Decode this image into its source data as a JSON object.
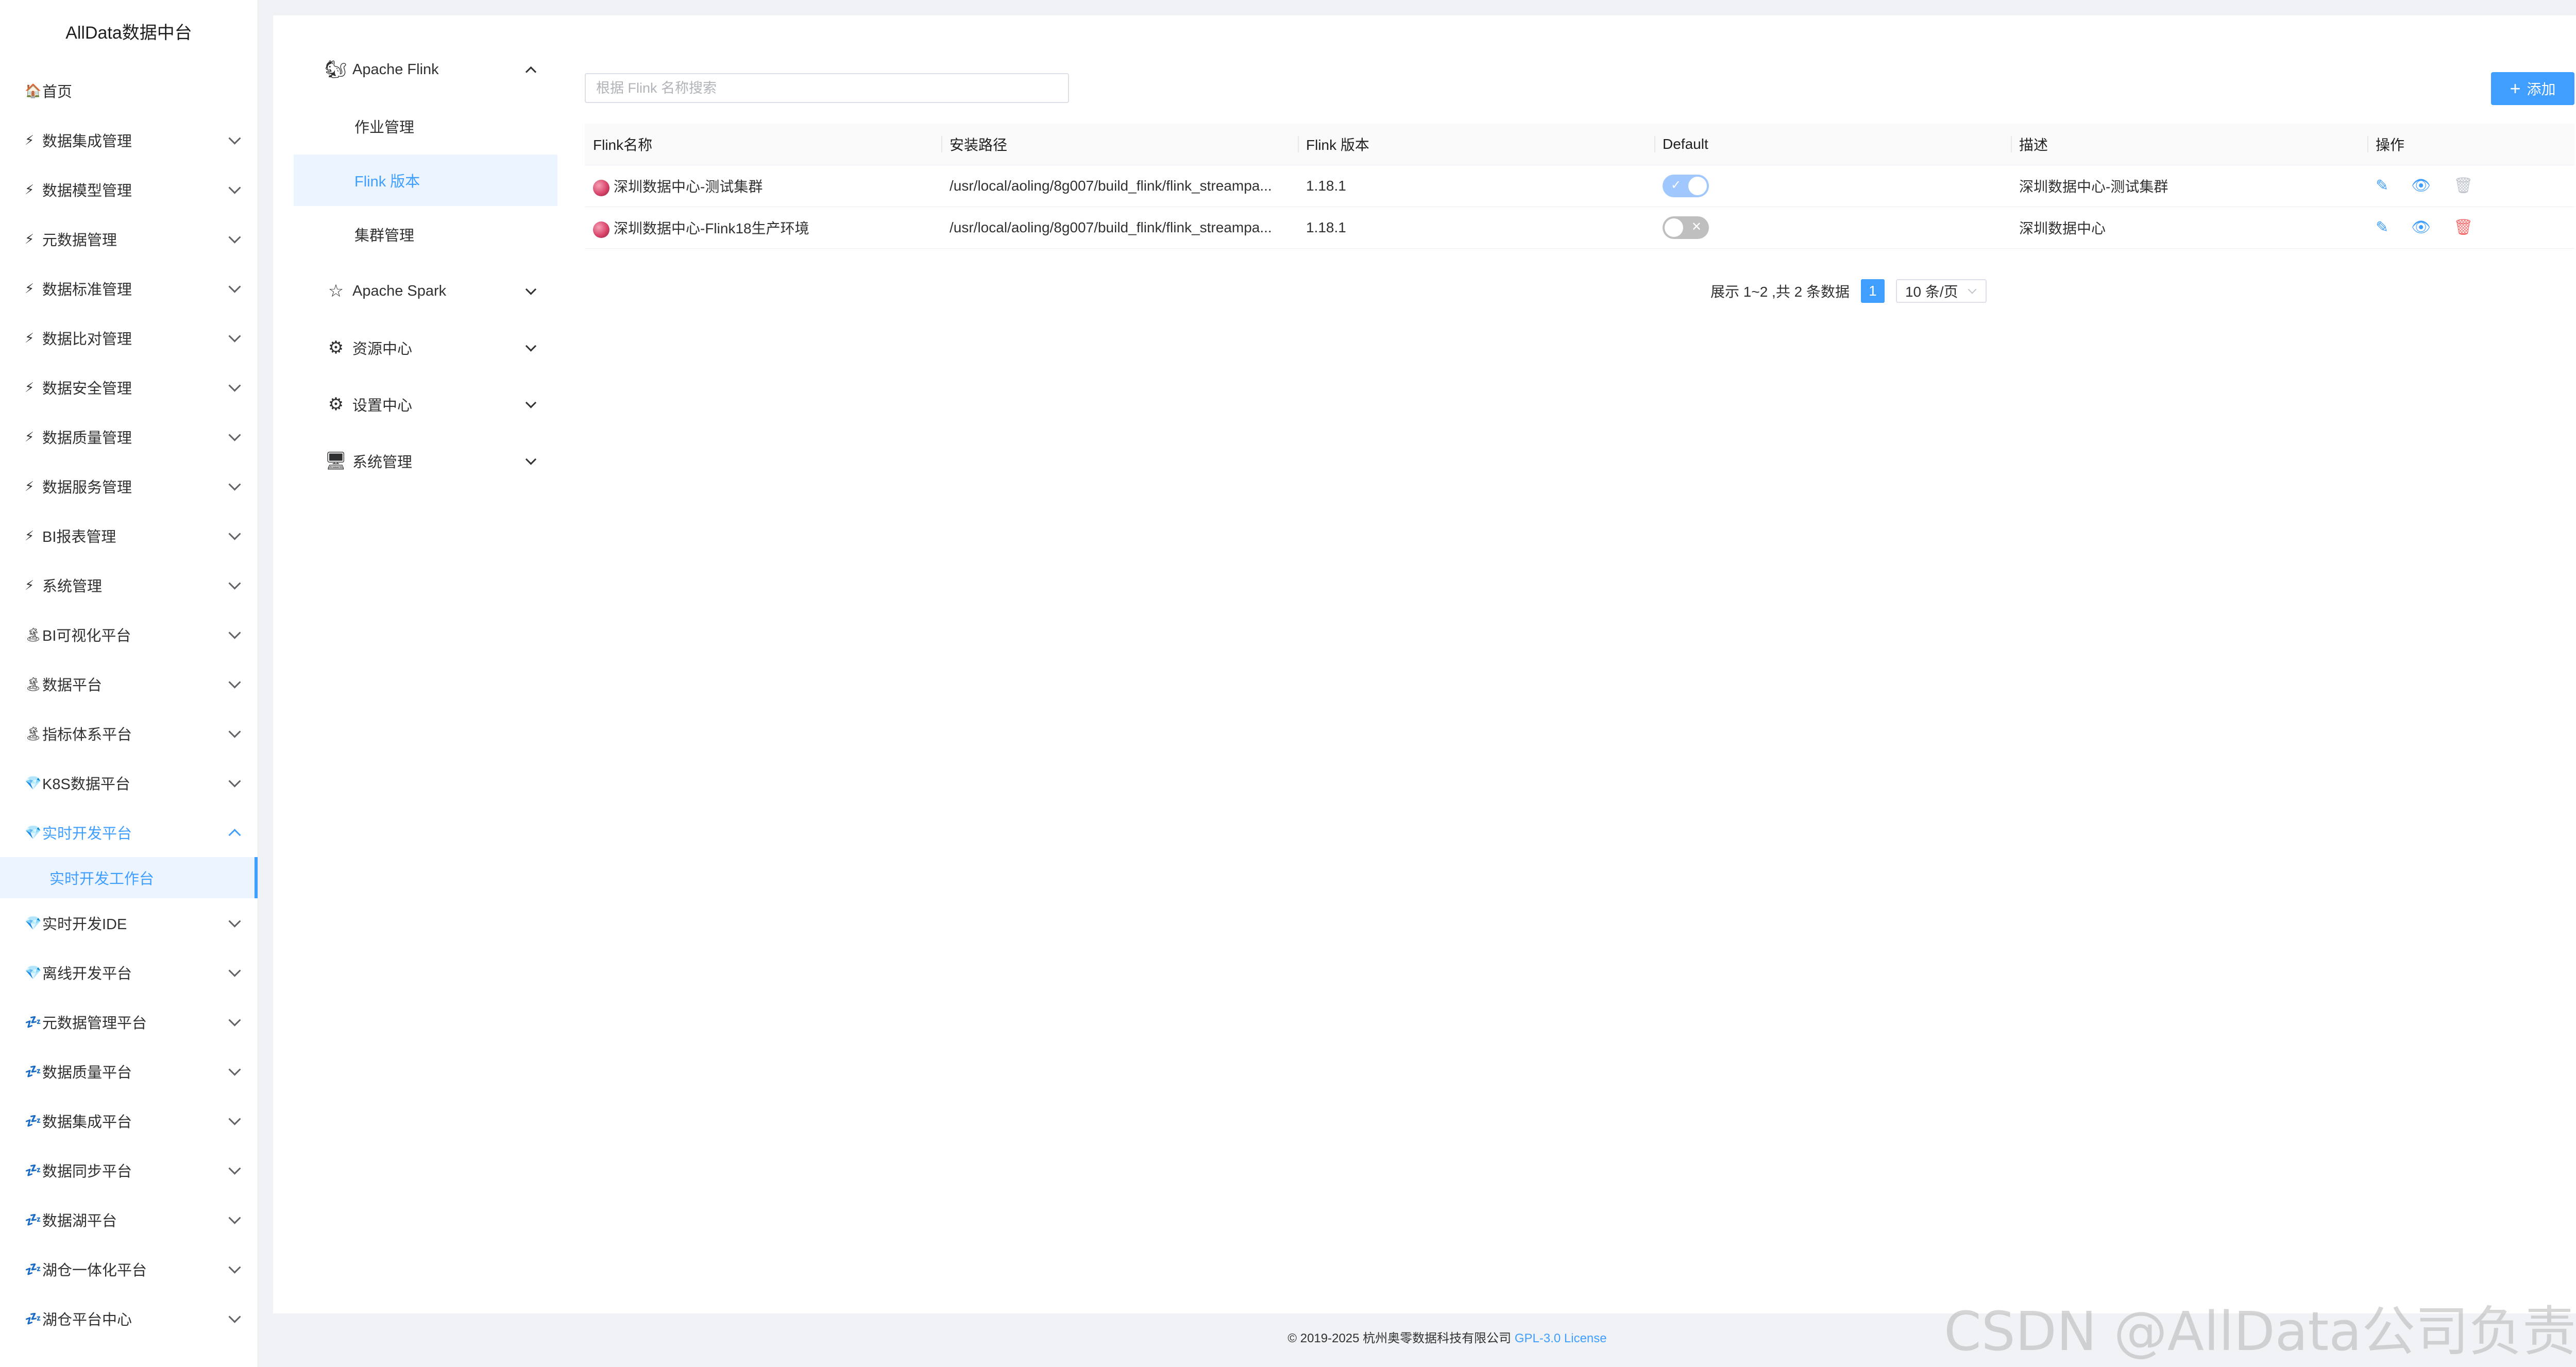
{
  "app": {
    "title": "AllData数据中台"
  },
  "sidebar": {
    "items": [
      {
        "label": "首页",
        "icon": "🏠",
        "arrow": false
      },
      {
        "label": "数据集成管理",
        "icon": "⚡",
        "arrow": true
      },
      {
        "label": "数据模型管理",
        "icon": "⚡",
        "arrow": true
      },
      {
        "label": "元数据管理",
        "icon": "⚡",
        "arrow": true
      },
      {
        "label": "数据标准管理",
        "icon": "⚡",
        "arrow": true
      },
      {
        "label": "数据比对管理",
        "icon": "⚡",
        "arrow": true
      },
      {
        "label": "数据安全管理",
        "icon": "⚡",
        "arrow": true
      },
      {
        "label": "数据质量管理",
        "icon": "⚡",
        "arrow": true
      },
      {
        "label": "数据服务管理",
        "icon": "⚡",
        "arrow": true
      },
      {
        "label": "BI报表管理",
        "icon": "⚡",
        "arrow": true
      },
      {
        "label": "系统管理",
        "icon": "⚡",
        "arrow": true
      },
      {
        "label": "BI可视化平台",
        "icon": "🏝",
        "arrow": true
      },
      {
        "label": "数据平台",
        "icon": "🏝",
        "arrow": true
      },
      {
        "label": "指标体系平台",
        "icon": "🏝",
        "arrow": true
      },
      {
        "label": "K8S数据平台",
        "icon": "💎",
        "arrow": true
      },
      {
        "label": "实时开发平台",
        "icon": "💎",
        "arrow": true,
        "open": true
      },
      {
        "label": "实时开发IDE",
        "icon": "💎",
        "arrow": true
      },
      {
        "label": "离线开发平台",
        "icon": "💎",
        "arrow": true
      },
      {
        "label": "元数据管理平台",
        "icon": "💤",
        "arrow": true
      },
      {
        "label": "数据质量平台",
        "icon": "💤",
        "arrow": true
      },
      {
        "label": "数据集成平台",
        "icon": "💤",
        "arrow": true
      },
      {
        "label": "数据同步平台",
        "icon": "💤",
        "arrow": true
      },
      {
        "label": "数据湖平台",
        "icon": "💤",
        "arrow": true
      },
      {
        "label": "湖仓一体化平台",
        "icon": "💤",
        "arrow": true
      },
      {
        "label": "湖仓平台中心",
        "icon": "💤",
        "arrow": true
      }
    ],
    "active_sub": "实时开发工作台"
  },
  "inner_menu": {
    "flink": {
      "label": "Apache Flink",
      "icon": "squirrel-icon"
    },
    "flink_subs": [
      {
        "label": "作业管理",
        "active": false
      },
      {
        "label": "Flink 版本",
        "active": true
      },
      {
        "label": "集群管理",
        "active": false
      }
    ],
    "groups": [
      {
        "label": "Apache Spark",
        "icon": "☆"
      },
      {
        "label": "资源中心",
        "icon": "⚙"
      },
      {
        "label": "设置中心",
        "icon": "⚙"
      },
      {
        "label": "系统管理",
        "icon": "🖥"
      }
    ]
  },
  "toolbar": {
    "search_placeholder": "根据 Flink 名称搜索",
    "add_label": "添加"
  },
  "table": {
    "columns": [
      "Flink名称",
      "安装路径",
      "Flink 版本",
      "Default",
      "描述",
      "操作"
    ],
    "rows": [
      {
        "name": "深圳数据中心-测试集群",
        "path": "/usr/local/aoling/8g007/build_flink/flink_streampa...",
        "version": "1.18.1",
        "default": true,
        "desc": "深圳数据中心-测试集群",
        "delete_enabled": false
      },
      {
        "name": "深圳数据中心-Flink18生产环境",
        "path": "/usr/local/aoling/8g007/build_flink/flink_streampa...",
        "version": "1.18.1",
        "default": false,
        "desc": "深圳数据中心",
        "delete_enabled": true
      }
    ]
  },
  "pagination": {
    "summary": "展示 1~2 ,共 2 条数据",
    "current_page": "1",
    "page_size": "10 条/页"
  },
  "footer": {
    "copyright": "© 2019-2025 杭州奥零数据科技有限公司",
    "license": "GPL-3.0 License"
  },
  "watermark": "CSDN @AllData公司负责人",
  "colors": {
    "accent": "#409eff",
    "danger": "#f56c6c",
    "background": "#f0f2f5"
  }
}
